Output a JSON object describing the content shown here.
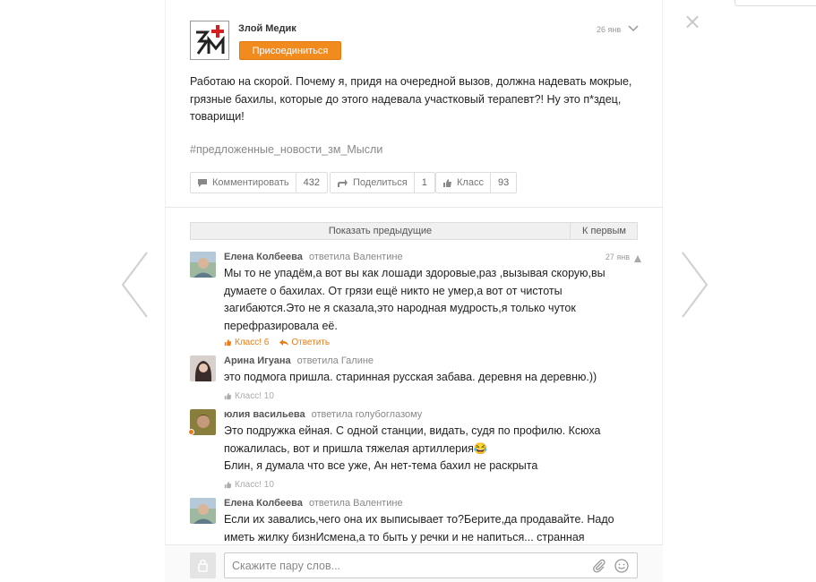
{
  "post": {
    "author": "Злой Медик",
    "join_label": "Присоединиться",
    "date": "26 янв",
    "text": "Работаю на скорой. Почему я, придя на очередной вызов, должна надевать мокрые, грязные бахилы, которые до этого надевала участковый терапевт?! Ну это п*здец, товарищи!",
    "hashtag": "#предложенные_новости_зм_Мысли",
    "actions": {
      "comment_label": "Комментировать",
      "comment_count": "432",
      "share_label": "Поделиться",
      "share_count": "1",
      "like_label": "Класс",
      "like_count": "93"
    },
    "logo_icon": "zm-logo-icon"
  },
  "comments_bar": {
    "show_previous": "Показать предыдущие",
    "to_first": "К первым"
  },
  "comments": [
    {
      "name": "Елена Колбеева",
      "reply_to": "ответила Валентине",
      "date": "27 янв",
      "text": "Мы то не упадём,а вот вы как лошади здоровые,раз ,вызывая скорую,вы думаете о бахилах. От грязи ещё никто не умер,а вот от чистоты загибаются.Это не я сказала,это народная мудрость,я только чуток перефразировала её.",
      "klass": "Класс! 6",
      "reply_label": "Ответить"
    },
    {
      "name": "Арина Игуана",
      "reply_to": "ответила Галине",
      "text": "это подмога пришла. старинная русская забава. деревня на деревню.))",
      "klass": "Класс! 10"
    },
    {
      "name": "юлия васильева",
      "reply_to": "ответила голубоглазому",
      "text": "Это подружка ейная. С одной станции, видать, судя по профилю. Ксюха пожалилась, вот и пришла тяжелая артиллерия😂",
      "text2": "Блин, я думала что все уже, Ан нет-тема бахил не раскрыта",
      "klass": "Класс! 10"
    },
    {
      "name": "Елена Колбеева",
      "reply_to": "ответила Валентине",
      "text": "Если их завались,чего она их выписывает то?Берите,да продавайте. Надо иметь жилку бизнИсмена,а то быть у речки и не напиться... странная"
    }
  ],
  "composer": {
    "placeholder": "Скажите пару слов..."
  },
  "colors": {
    "accent": "#f28b1e",
    "accent_text": "#f07a10"
  }
}
